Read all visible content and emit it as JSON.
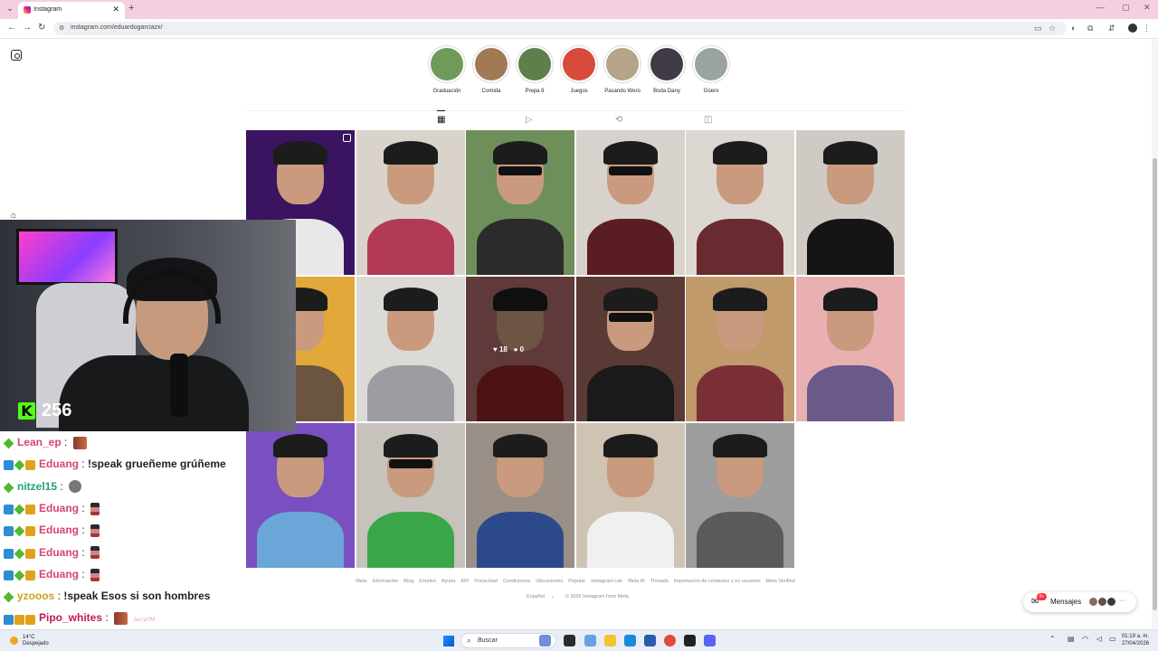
{
  "browser": {
    "tab_title": "Instagram",
    "tab_close": "✕",
    "new_tab": "+",
    "url": "instagram.com/eduardogarciazx/",
    "win_min": "—",
    "win_max": "▢",
    "win_close": "✕"
  },
  "highlights": [
    {
      "label": "Graduación",
      "color": "#6f9a5a"
    },
    {
      "label": "Comida",
      "color": "#a07a55"
    },
    {
      "label": "Prepa 8",
      "color": "#5e7f4a"
    },
    {
      "label": "Juegos",
      "color": "#d84a3a"
    },
    {
      "label": "Pasando Wero",
      "color": "#b5a48a"
    },
    {
      "label": "Boda Dany",
      "color": "#3f3a44"
    },
    {
      "label": "Güero",
      "color": "#9aa3a1"
    }
  ],
  "grid": {
    "hover_stats": {
      "likes": "18",
      "comments": "0"
    },
    "posts": [
      {
        "bg": "#3a1460",
        "shirt": "#e8e8e8",
        "shades": false,
        "reel": true
      },
      {
        "bg": "#d9d3cc",
        "shirt": "#b23a55",
        "shades": false,
        "reel": false
      },
      {
        "bg": "#6e8f5a",
        "shirt": "#2b2b2b",
        "shades": true,
        "reel": false
      },
      {
        "bg": "#d7d2cc",
        "shirt": "#5a1e22",
        "shades": true,
        "reel": false
      },
      {
        "bg": "#dcd7d0",
        "shirt": "#6a2b30",
        "shades": false,
        "reel": false
      },
      {
        "bg": "#cfcac4",
        "shirt": "#151515",
        "shades": false,
        "reel": false
      },
      {
        "bg": "#e3a83a",
        "shirt": "#6b5540",
        "shades": false,
        "reel": false
      },
      {
        "bg": "#dcdad6",
        "shirt": "#9b9da3",
        "shades": false,
        "reel": false
      },
      {
        "bg": "#b06a6a",
        "shirt": "#8a2424",
        "shades": false,
        "reel": false,
        "hover": true
      },
      {
        "bg": "#5a3a35",
        "shirt": "#1a1a1a",
        "shades": true,
        "reel": false
      },
      {
        "bg": "#c09a6a",
        "shirt": "#7a2e36",
        "shades": false,
        "reel": false
      },
      {
        "bg": "#e8b0b0",
        "shirt": "#6a5a8a",
        "shades": false,
        "reel": false
      },
      {
        "bg": "#7a4fc0",
        "shirt": "#6aa6d8",
        "shades": false,
        "reel": false
      },
      {
        "bg": "#c7c2bc",
        "shirt": "#3aa64a",
        "shades": true,
        "reel": false
      },
      {
        "bg": "#9a8f86",
        "shirt": "#2c4a8a",
        "shades": false,
        "reel": false
      },
      {
        "bg": "#cfc4b4",
        "shirt": "#f0f0f0",
        "shades": false,
        "reel": false
      },
      {
        "bg": "#9d9d9d",
        "shirt": "#5a5a5a",
        "shades": false,
        "reel": false
      }
    ]
  },
  "footer": {
    "links": [
      "Meta",
      "Información",
      "Blog",
      "Empleo",
      "Ayuda",
      "API",
      "Privacidad",
      "Condiciones",
      "Ubicaciones",
      "Popular",
      "Instagram Lite",
      "Meta AI",
      "Threads",
      "Importación de contactos y no usuarios",
      "Meta Verified"
    ],
    "language": "Español",
    "copyright": "© 2026 Instagram from Meta"
  },
  "messages": {
    "label": "Mensajes",
    "badge": "9+"
  },
  "stream": {
    "viewer_count": "256",
    "kick_letter": "K"
  },
  "chat": [
    {
      "user": "Lean_ep",
      "color": "#d6456b",
      "badges": [
        "green"
      ],
      "text": "",
      "emote": "rect"
    },
    {
      "user": "Eduang",
      "color": "#d6456b",
      "badges": [
        "blue",
        "green",
        "gold"
      ],
      "text": "!speak grueñeme grúñeme",
      "emote": ""
    },
    {
      "user": "nitzel15",
      "color": "#1fa37a",
      "badges": [
        "green"
      ],
      "text": "",
      "emote": "cat"
    },
    {
      "user": "Eduang",
      "color": "#d6456b",
      "badges": [
        "blue",
        "green",
        "gold"
      ],
      "text": "",
      "emote": "pixel"
    },
    {
      "user": "Eduang",
      "color": "#d6456b",
      "badges": [
        "blue",
        "green",
        "gold"
      ],
      "text": "",
      "emote": "pixel"
    },
    {
      "user": "Eduang",
      "color": "#d6456b",
      "badges": [
        "blue",
        "green",
        "gold"
      ],
      "text": "",
      "emote": "pixel"
    },
    {
      "user": "Eduang",
      "color": "#d6456b",
      "badges": [
        "blue",
        "green",
        "gold"
      ],
      "text": "",
      "emote": "pixel"
    },
    {
      "user": "yzooos",
      "color": "#c9a31c",
      "badges": [
        "green"
      ],
      "text": "!speak Esos si son hombres",
      "emote": ""
    },
    {
      "user": "Pipo_whites",
      "color": "#c2185b",
      "badges": [
        "blue",
        "gold",
        "gold"
      ],
      "text": "",
      "emote": "rect",
      "ghost": "Jacryl7M"
    }
  ],
  "taskbar": {
    "temp": "14°C",
    "weather": "Despejado",
    "search_placeholder": "Buscar",
    "time": "01:19 a. m.",
    "date": "27/04/2026"
  }
}
